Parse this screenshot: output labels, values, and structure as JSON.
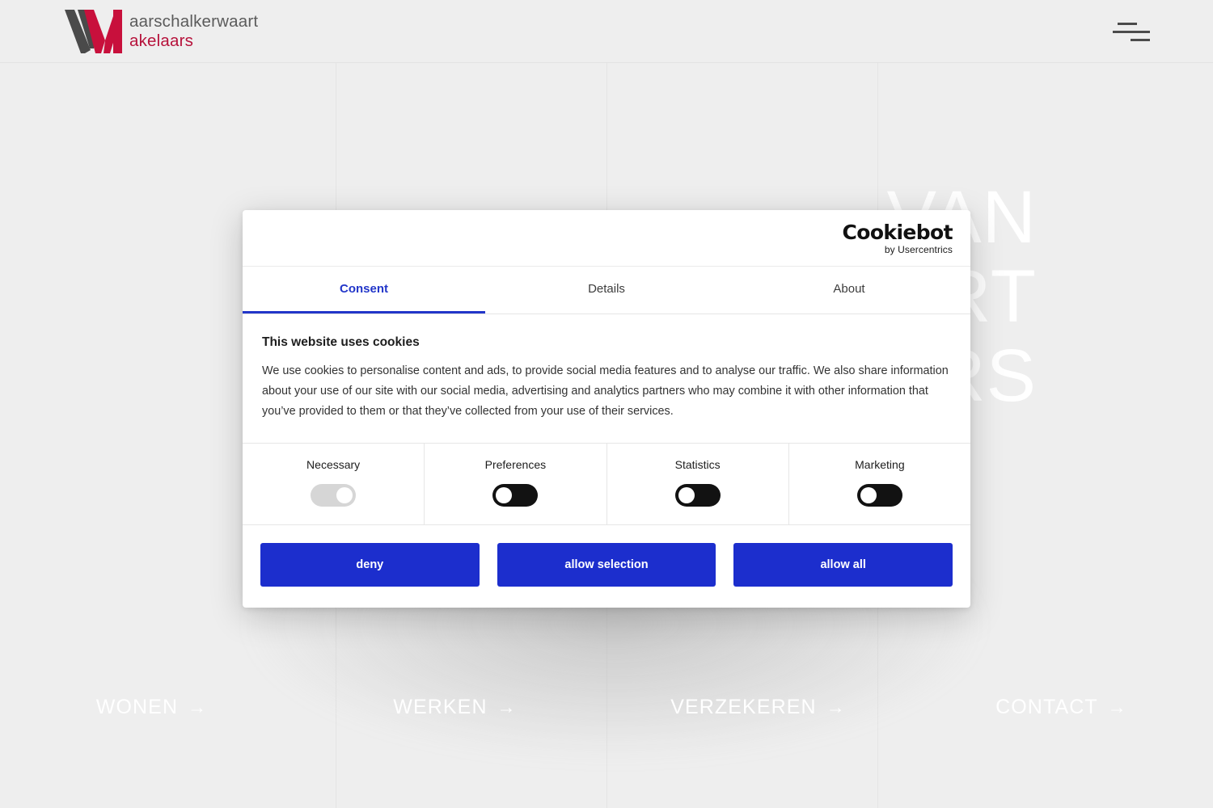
{
  "site": {
    "brand": {
      "mark_alt": "VM monogram",
      "line1": "aarschalkerwaart",
      "line2": "akelaars",
      "mark_color_dark": "#4a4a4a",
      "mark_color_red": "#c8103c"
    },
    "menu_button_label": "menu",
    "hero_lines": [
      "VAN",
      "WAART",
      "LAARS"
    ],
    "quad_nav": [
      {
        "label": "WONEN",
        "arrow": "→"
      },
      {
        "label": "WERKEN",
        "arrow": "→"
      },
      {
        "label": "VERZEKEREN",
        "arrow": "→"
      },
      {
        "label": "CONTACT",
        "arrow": "→"
      }
    ]
  },
  "dialog": {
    "logo": {
      "name": "Cookiebot",
      "sub": "by Usercentrics"
    },
    "tabs": [
      {
        "label": "Consent",
        "active": true
      },
      {
        "label": "Details",
        "active": false
      },
      {
        "label": "About",
        "active": false
      }
    ],
    "heading": "This website uses cookies",
    "description": "We use cookies to personalise content and ads, to provide social media features and to analyse our traffic. We also share information about your use of our site with our social media, advertising and analytics partners who may combine it with other information that you’ve provided to them or that they’ve collected from your use of their services.",
    "categories": [
      {
        "label": "Necessary",
        "state": "on-locked"
      },
      {
        "label": "Preferences",
        "state": "off"
      },
      {
        "label": "Statistics",
        "state": "off"
      },
      {
        "label": "Marketing",
        "state": "off"
      }
    ],
    "buttons": [
      {
        "label": "deny"
      },
      {
        "label": "allow selection"
      },
      {
        "label": "allow all"
      }
    ],
    "accent_color": "#1c2ecd"
  }
}
